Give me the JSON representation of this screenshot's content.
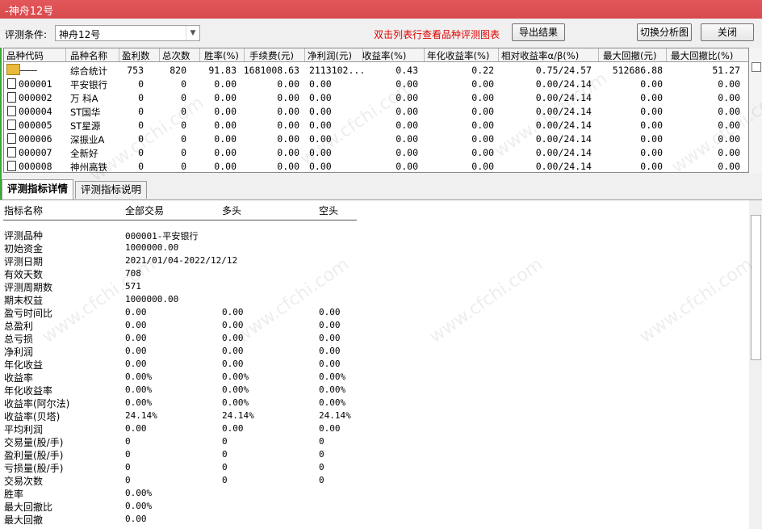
{
  "window": {
    "title": "-神舟12号"
  },
  "toolbar": {
    "condition_label": "评测条件:",
    "condition_value": "神舟12号",
    "hint": "双击列表行查看品种评测图表",
    "export_label": "导出结果",
    "switch_label": "切换分析图",
    "close_label": "关闭"
  },
  "grid": {
    "columns": [
      "品种代码",
      "品种名称",
      "盈利数",
      "总次数",
      "胜率(%)",
      "手续费(元)",
      "净利润(元)",
      "收益率(%)",
      "年化收益率(%)",
      "相对收益率α/β(%)",
      "最大回撤(元)",
      "最大回撤比(%)"
    ],
    "rows": [
      {
        "code": "———",
        "name": "综合统计",
        "win": "753",
        "total": "820",
        "rate": "91.83",
        "fee": "1681008.63",
        "profit": "2113102...",
        "ret": "0.43",
        "annual": "0.22",
        "ab": "0.75/24.57",
        "mdd": "512686.88",
        "mddr": "51.27",
        "icon": "folder-icon"
      },
      {
        "code": "000001",
        "name": "平安银行",
        "win": "0",
        "total": "0",
        "rate": "0.00",
        "fee": "0.00",
        "profit": "0.00",
        "ret": "0.00",
        "annual": "0.00",
        "ab": "0.00/24.14",
        "mdd": "0.00",
        "mddr": "0.00",
        "icon": "document-icon"
      },
      {
        "code": "000002",
        "name": "万 科A",
        "win": "0",
        "total": "0",
        "rate": "0.00",
        "fee": "0.00",
        "profit": "0.00",
        "ret": "0.00",
        "annual": "0.00",
        "ab": "0.00/24.14",
        "mdd": "0.00",
        "mddr": "0.00",
        "icon": "document-icon"
      },
      {
        "code": "000004",
        "name": "ST国华",
        "win": "0",
        "total": "0",
        "rate": "0.00",
        "fee": "0.00",
        "profit": "0.00",
        "ret": "0.00",
        "annual": "0.00",
        "ab": "0.00/24.14",
        "mdd": "0.00",
        "mddr": "0.00",
        "icon": "document-icon"
      },
      {
        "code": "000005",
        "name": "ST星源",
        "win": "0",
        "total": "0",
        "rate": "0.00",
        "fee": "0.00",
        "profit": "0.00",
        "ret": "0.00",
        "annual": "0.00",
        "ab": "0.00/24.14",
        "mdd": "0.00",
        "mddr": "0.00",
        "icon": "document-icon"
      },
      {
        "code": "000006",
        "name": "深振业A",
        "win": "0",
        "total": "0",
        "rate": "0.00",
        "fee": "0.00",
        "profit": "0.00",
        "ret": "0.00",
        "annual": "0.00",
        "ab": "0.00/24.14",
        "mdd": "0.00",
        "mddr": "0.00",
        "icon": "document-icon"
      },
      {
        "code": "000007",
        "name": "全新好",
        "win": "0",
        "total": "0",
        "rate": "0.00",
        "fee": "0.00",
        "profit": "0.00",
        "ret": "0.00",
        "annual": "0.00",
        "ab": "0.00/24.14",
        "mdd": "0.00",
        "mddr": "0.00",
        "icon": "document-icon"
      },
      {
        "code": "000008",
        "name": "神州高铁",
        "win": "0",
        "total": "0",
        "rate": "0.00",
        "fee": "0.00",
        "profit": "0.00",
        "ret": "0.00",
        "annual": "0.00",
        "ab": "0.00/24.14",
        "mdd": "0.00",
        "mddr": "0.00",
        "icon": "document-icon"
      }
    ]
  },
  "tabs": [
    {
      "label": "评测指标详情",
      "active": true
    },
    {
      "label": "评测指标说明",
      "active": false
    }
  ],
  "detail": {
    "headers": [
      "指标名称",
      "全部交易",
      "多头",
      "空头"
    ],
    "rows": [
      {
        "name": "评测品种",
        "all": "000001-平安银行",
        "long": "",
        "short": ""
      },
      {
        "name": "初始资金",
        "all": "1000000.00",
        "long": "",
        "short": ""
      },
      {
        "name": "评测日期",
        "all": "2021/01/04-2022/12/12",
        "long": "",
        "short": ""
      },
      {
        "name": "有效天数",
        "all": "708",
        "long": "",
        "short": ""
      },
      {
        "name": "评测周期数",
        "all": "571",
        "long": "",
        "short": ""
      },
      {
        "name": "期末权益",
        "all": "1000000.00",
        "long": "",
        "short": ""
      },
      {
        "name": "盈亏时间比",
        "all": "0.00",
        "long": "0.00",
        "short": "0.00"
      },
      {
        "name": "总盈利",
        "all": "0.00",
        "long": "0.00",
        "short": "0.00"
      },
      {
        "name": "总亏损",
        "all": "0.00",
        "long": "0.00",
        "short": "0.00"
      },
      {
        "name": "净利润",
        "all": "0.00",
        "long": "0.00",
        "short": "0.00"
      },
      {
        "name": "年化收益",
        "all": "0.00",
        "long": "0.00",
        "short": "0.00"
      },
      {
        "name": "收益率",
        "all": "0.00%",
        "long": "0.00%",
        "short": "0.00%"
      },
      {
        "name": "年化收益率",
        "all": "0.00%",
        "long": "0.00%",
        "short": "0.00%"
      },
      {
        "name": "收益率(阿尔法)",
        "all": "0.00%",
        "long": "0.00%",
        "short": "0.00%"
      },
      {
        "name": "收益率(贝塔)",
        "all": "24.14%",
        "long": "24.14%",
        "short": "24.14%"
      },
      {
        "name": "平均利润",
        "all": "0.00",
        "long": "0.00",
        "short": "0.00"
      },
      {
        "name": "交易量(股/手)",
        "all": "0",
        "long": "0",
        "short": "0"
      },
      {
        "name": "盈利量(股/手)",
        "all": "0",
        "long": "0",
        "short": "0"
      },
      {
        "name": "亏损量(股/手)",
        "all": "0",
        "long": "0",
        "short": "0"
      },
      {
        "name": "交易次数",
        "all": "0",
        "long": "0",
        "short": "0"
      },
      {
        "name": "胜率",
        "all": "0.00%",
        "long": "",
        "short": ""
      },
      {
        "name": "最大回撤比",
        "all": "0.00%",
        "long": "",
        "short": ""
      },
      {
        "name": "最大回撤",
        "all": "0.00",
        "long": "",
        "short": ""
      }
    ]
  },
  "watermark": "www.cfchi.com",
  "colors": {
    "titlebar": "#d84a4d",
    "hint": "#e00000"
  }
}
